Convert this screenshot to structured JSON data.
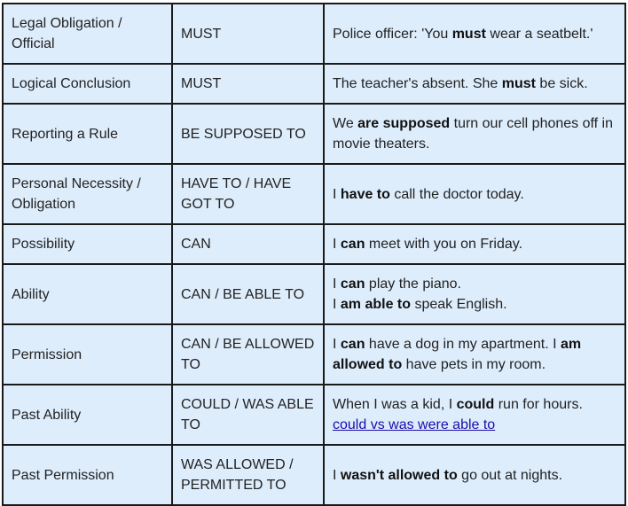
{
  "table": {
    "rows": [
      {
        "use": "Legal Obligation / Official",
        "modal": "MUST",
        "example": [
          [
            {
              "t": "Police officer: 'You "
            },
            {
              "t": "must",
              "b": true
            },
            {
              "t": " wear a seatbelt.'"
            }
          ]
        ]
      },
      {
        "use": "Logical Conclusion",
        "modal": "MUST",
        "example": [
          [
            {
              "t": "The teacher's absent. She "
            },
            {
              "t": "must",
              "b": true
            },
            {
              "t": " be sick."
            }
          ]
        ]
      },
      {
        "use": "Reporting a Rule",
        "modal": "BE SUPPOSED TO",
        "example": [
          [
            {
              "t": "We "
            },
            {
              "t": "are supposed",
              "b": true
            },
            {
              "t": " turn our cell phones off in movie theaters."
            }
          ]
        ]
      },
      {
        "use": "Personal Necessity / Obligation",
        "modal": "HAVE TO / HAVE GOT TO",
        "example": [
          [
            {
              "t": "I "
            },
            {
              "t": "have to",
              "b": true
            },
            {
              "t": " call the doctor today."
            }
          ]
        ]
      },
      {
        "use": "Possibility",
        "modal": "CAN",
        "example": [
          [
            {
              "t": "I "
            },
            {
              "t": "can",
              "b": true
            },
            {
              "t": " meet with you on Friday."
            }
          ]
        ]
      },
      {
        "use": "Ability",
        "modal": "CAN / BE ABLE TO",
        "example": [
          [
            {
              "t": "I "
            },
            {
              "t": "can",
              "b": true
            },
            {
              "t": " play the piano."
            }
          ],
          [
            {
              "t": "I "
            },
            {
              "t": "am able to",
              "b": true
            },
            {
              "t": " speak English."
            }
          ]
        ]
      },
      {
        "use": "Permission",
        "modal": "CAN / BE ALLOWED TO",
        "example": [
          [
            {
              "t": "I "
            },
            {
              "t": "can",
              "b": true
            },
            {
              "t": " have a dog in my apartment. I "
            },
            {
              "t": "am allowed to",
              "b": true
            },
            {
              "t": " have pets in my room."
            }
          ]
        ]
      },
      {
        "use": "Past Ability",
        "modal": "COULD / WAS ABLE TO",
        "example": [
          [
            {
              "t": "When I was a kid, I "
            },
            {
              "t": "could",
              "b": true
            },
            {
              "t": " run for hours."
            }
          ],
          [
            {
              "t": "could vs was were able to",
              "link": true
            }
          ]
        ]
      },
      {
        "use": "Past Permission",
        "modal": "WAS ALLOWED / PERMITTED TO",
        "example": [
          [
            {
              "t": "I "
            },
            {
              "t": "wasn't allowed to",
              "b": true
            },
            {
              "t": " go out at nights."
            }
          ]
        ]
      }
    ]
  },
  "colors": {
    "cell_background": "#deedfc",
    "border": "#1a1a1a",
    "link": "#1a0dab"
  }
}
